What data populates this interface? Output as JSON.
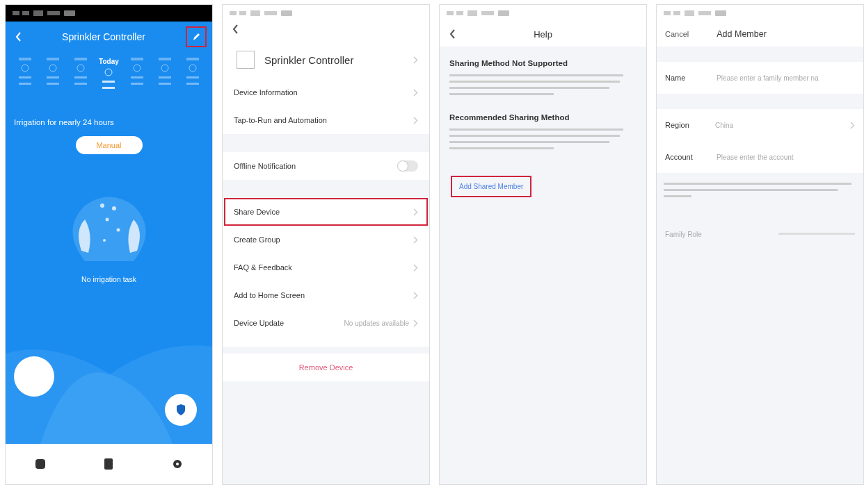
{
  "screens": [
    {
      "kind": "controller",
      "title": "Sprinkler Controller",
      "edit_highlighted": true,
      "today_label": "Today",
      "status_text": "Irrigation for nearly 24 hours",
      "mode_button": "Manual",
      "empty_text": "No irrigation task"
    },
    {
      "kind": "settings",
      "title": "Sprinkler Controller",
      "items": [
        {
          "kind": "link",
          "label": "Device Information",
          "highlighted": false
        },
        {
          "kind": "link",
          "label": "Tap-to-Run and Automation",
          "highlighted": false
        },
        {
          "kind": "toggle",
          "label": "Offline Notification",
          "on": false,
          "highlighted": false
        },
        {
          "kind": "link",
          "label": "Share Device",
          "highlighted": true
        },
        {
          "kind": "link",
          "label": "Create Group",
          "highlighted": false
        },
        {
          "kind": "link",
          "label": "FAQ & Feedback",
          "highlighted": false
        },
        {
          "kind": "link",
          "label": "Add to Home Screen",
          "highlighted": false
        },
        {
          "kind": "link",
          "label": "Device Update",
          "value": "No updates available",
          "highlighted": false
        }
      ],
      "remove_button": "Remove Device"
    },
    {
      "kind": "help",
      "title": "Help",
      "sections": [
        {
          "heading": "Sharing Method Not Supported"
        },
        {
          "heading": "Recommended Sharing Method"
        }
      ],
      "action": "Add Shared Member",
      "action_highlighted": true
    },
    {
      "kind": "form",
      "cancel": "Cancel",
      "title": "Add Member",
      "fields": [
        {
          "label": "Name",
          "placeholder": "Please enter a family member na"
        },
        {
          "label": "Region",
          "value": "China"
        },
        {
          "label": "Account",
          "placeholder": "Please enter the account"
        }
      ],
      "footer_label": "Family Role"
    }
  ]
}
